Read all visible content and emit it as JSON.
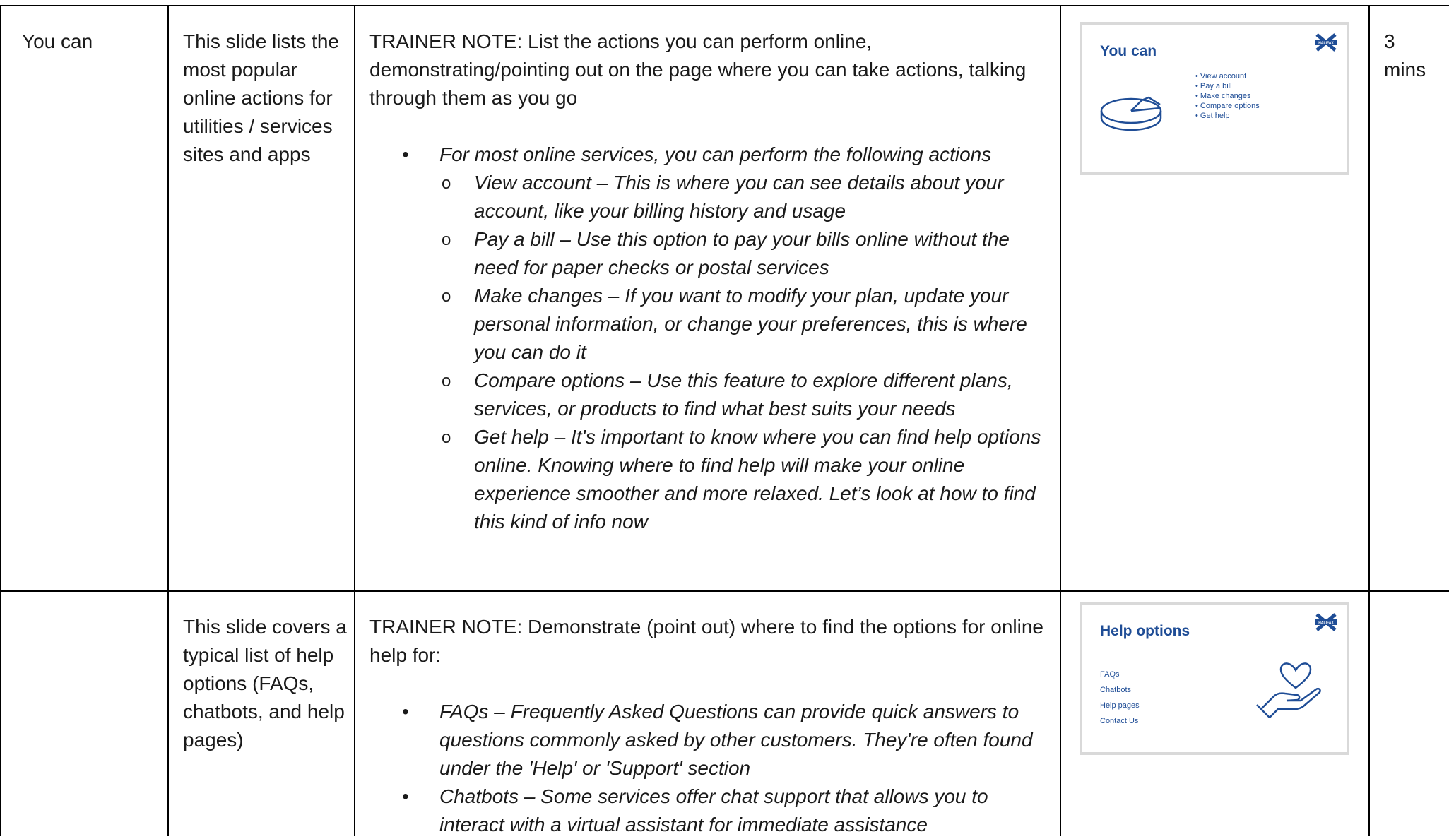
{
  "rows": [
    {
      "title": "You can",
      "description": "This slide lists the most popular online actions for utilities / services sites and apps",
      "note_intro": "TRAINER NOTE: List the actions you can perform online, demonstrating/pointing out on the page where you can take actions, talking through them as you go",
      "bullets": [
        {
          "text": "For most online services, you can perform the following actions",
          "sub": [
            "View account – This is where you can see details about your account, like your billing history and usage",
            "Pay a bill – Use this option to pay your bills online without the need for paper checks or postal services",
            "Make changes – If you want to modify your plan, update your personal information, or change your preferences, this is where you can do it",
            "Compare options – Use this feature to explore different plans, services, or products to find what best suits your needs",
            "Get help – It's important to know where you can find help options online. Knowing where to find help will make your online experience smoother and more relaxed. Let’s look at how to find this kind of info now"
          ]
        }
      ],
      "slide": {
        "title": "You can",
        "items": [
          "View account",
          "Pay a bill",
          "Make changes",
          "Compare options",
          "Get help"
        ],
        "logo_text": "HALIFAX",
        "illustration": "pie-chart-icon"
      },
      "time_value": "3",
      "time_unit": "mins"
    },
    {
      "title": "",
      "description": "This slide covers a typical list of help options (FAQs, chatbots, and help pages)",
      "note_intro": "TRAINER NOTE: Demonstrate (point out) where to find the options for online help for:",
      "bullets": [
        "FAQs – Frequently Asked Questions can provide quick answers to questions commonly asked by other customers. They're often found under the 'Help' or 'Support' section",
        "Chatbots – Some services offer chat support that allows you to interact with a virtual assistant for immediate assistance"
      ],
      "slide": {
        "title": "Help options",
        "items": [
          "FAQs",
          "Chatbots",
          "Help pages",
          "Contact Us"
        ],
        "logo_text": "HALIFAX",
        "illustration": "heart-in-hand-icon"
      },
      "time_value": ""
    }
  ],
  "colors": {
    "slide_title": "#1f4d96",
    "table_border": "#000000",
    "thumb_border": "#d9d9d9"
  }
}
